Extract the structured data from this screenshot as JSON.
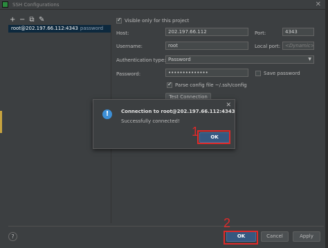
{
  "window": {
    "title": "SSH Configurations",
    "close_glyph": "✕"
  },
  "toolbar": {
    "add": "+",
    "remove": "−",
    "copy": "⧉",
    "edit": "✎"
  },
  "list": {
    "items": [
      {
        "host": "root@202.197.66.112:4343",
        "auth": "password"
      }
    ]
  },
  "form": {
    "visible_only_label": "Visible only for this project",
    "host_label": "Host:",
    "host_value": "202.197.66.112",
    "port_label": "Port:",
    "port_value": "4343",
    "username_label": "Username:",
    "username_value": "root",
    "local_port_label": "Local port:",
    "local_port_placeholder": "<Dynamic>",
    "auth_type_label": "Authentication type:",
    "auth_type_value": "Password",
    "password_label": "Password:",
    "password_value": "••••••••••••••",
    "save_password_label": "Save password",
    "parse_config_label": "Parse config file ~/.ssh/config",
    "test_connection_label": "Test Connection"
  },
  "dialog": {
    "title": "Connection to root@202.197.66.112:4343",
    "message": "Successfully connected!",
    "ok_label": "OK",
    "close_glyph": "✕",
    "info_glyph": "!"
  },
  "footer": {
    "help": "?",
    "ok_label": "OK",
    "cancel_label": "Cancel",
    "apply_label": "Apply"
  },
  "annotations": {
    "step1": "1",
    "step2": "2",
    "color": "#e02a2a"
  }
}
